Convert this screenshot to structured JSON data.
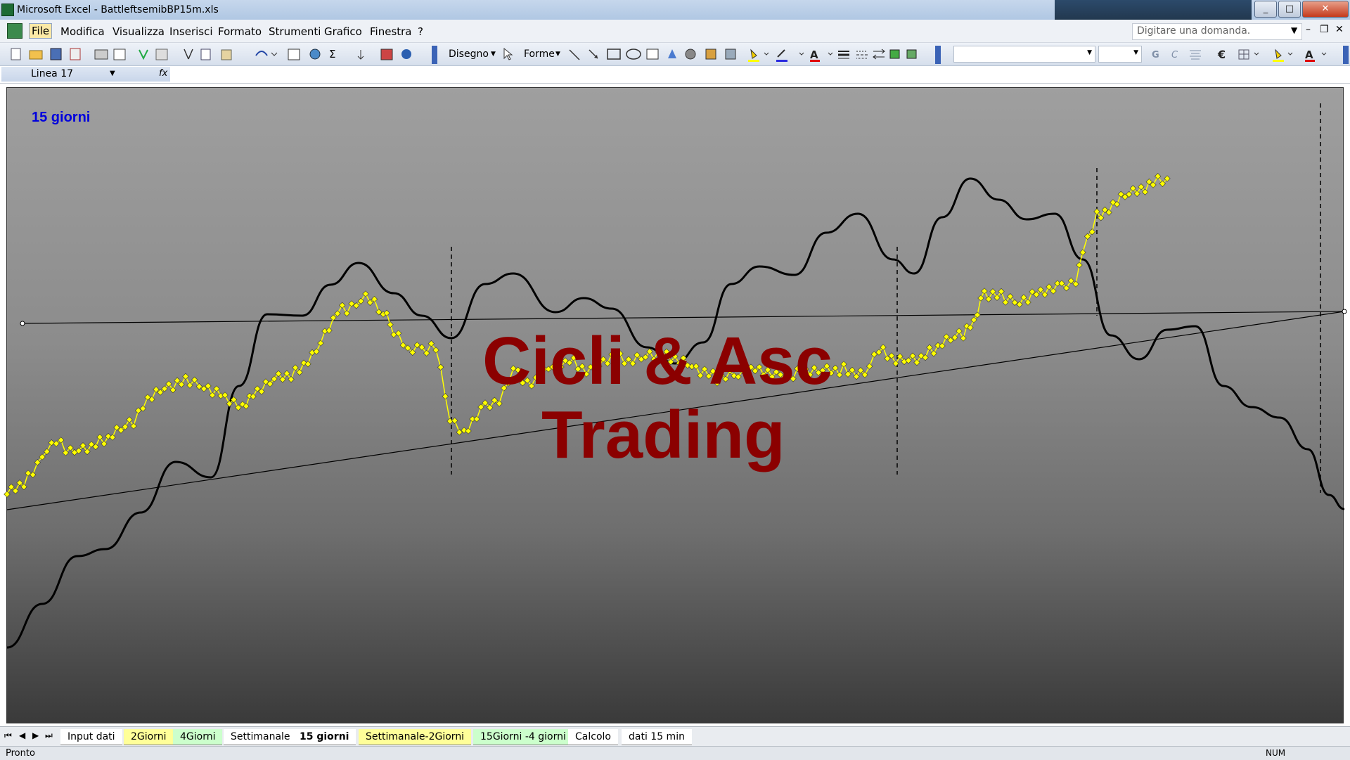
{
  "window": {
    "title": "Microsoft Excel - BattleftsemibBP15m.xls",
    "controls": {
      "minimize": "_",
      "maximize": "□",
      "close": "✕"
    }
  },
  "menu": {
    "items": [
      "File",
      "Modifica",
      "Visualizza",
      "Inserisci",
      "Formato",
      "Strumenti",
      "Grafico",
      "Finestra",
      "?"
    ],
    "help_placeholder": "Digitare una domanda."
  },
  "toolbar": {
    "draw_label": "Disegno",
    "shapes_label": "Forme"
  },
  "formula_bar": {
    "name_box": "Linea 17"
  },
  "chart": {
    "title": "15 giorni",
    "watermark_line1": "Cicli & Asc",
    "watermark_line2": "Trading"
  },
  "sheet_tabs": [
    {
      "label": "Input dati",
      "color": "#ffffff",
      "active": false
    },
    {
      "label": "2Giorni",
      "color": "#ffff99",
      "active": false
    },
    {
      "label": "4Giorni",
      "color": "#ccffcc",
      "active": false
    },
    {
      "label": "Settimanale",
      "color": "#ffffff",
      "active": false
    },
    {
      "label": "15 giorni",
      "color": "#ffffff",
      "active": true
    },
    {
      "label": "Settimanale-2Giorni",
      "color": "#ffff99",
      "active": false
    },
    {
      "label": "15Giorni -4 giorni",
      "color": "#ccffcc",
      "active": false
    },
    {
      "label": "Calcolo",
      "color": "#ffffff",
      "active": false
    },
    {
      "label": "dati 15 min",
      "color": "#ffffff",
      "active": false
    }
  ],
  "status": {
    "left": "Pronto",
    "num": "NUM"
  },
  "colors": {
    "price_series": "#ffff00",
    "cycle_line": "#000000",
    "title": "#0000dd",
    "watermark": "#8b0000"
  }
}
